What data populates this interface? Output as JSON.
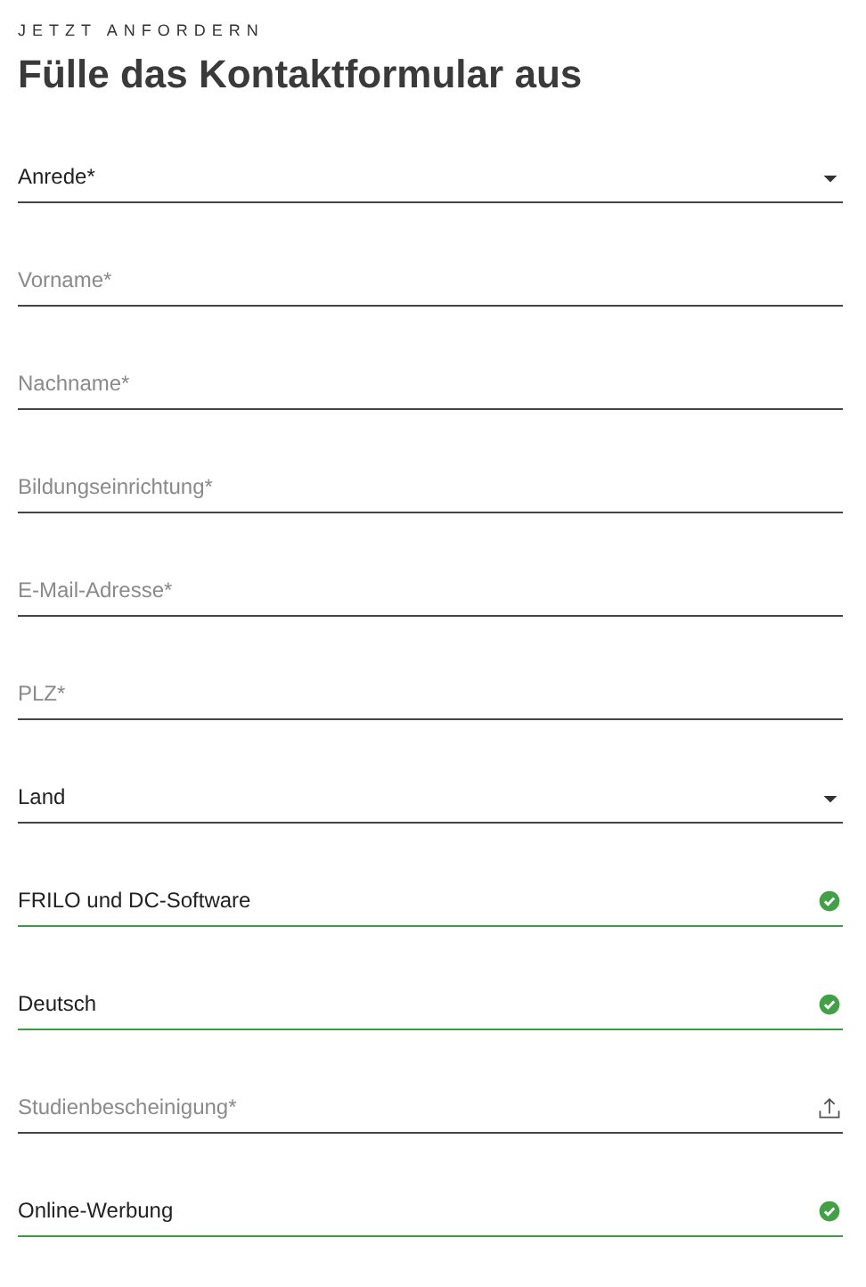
{
  "eyebrow": "JETZT ANFORDERN",
  "title": "Fülle das Kontaktformular aus",
  "fields": [
    {
      "kind": "select",
      "label": "Anrede*",
      "valid": false
    },
    {
      "kind": "text",
      "placeholder": "Vorname*",
      "valid": false
    },
    {
      "kind": "text",
      "placeholder": "Nachname*",
      "valid": false
    },
    {
      "kind": "text",
      "placeholder": "Bildungseinrichtung*",
      "valid": false
    },
    {
      "kind": "text",
      "placeholder": "E-Mail-Adresse*",
      "valid": false
    },
    {
      "kind": "text",
      "placeholder": "PLZ*",
      "valid": false
    },
    {
      "kind": "select",
      "label": "Land",
      "valid": false
    },
    {
      "kind": "text",
      "value": "FRILO und DC-Software",
      "valid": true
    },
    {
      "kind": "text",
      "value": "Deutsch",
      "valid": true
    },
    {
      "kind": "file",
      "placeholder": "Studienbescheinigung*",
      "valid": false
    },
    {
      "kind": "text",
      "value": "Online-Werbung",
      "valid": true
    }
  ]
}
